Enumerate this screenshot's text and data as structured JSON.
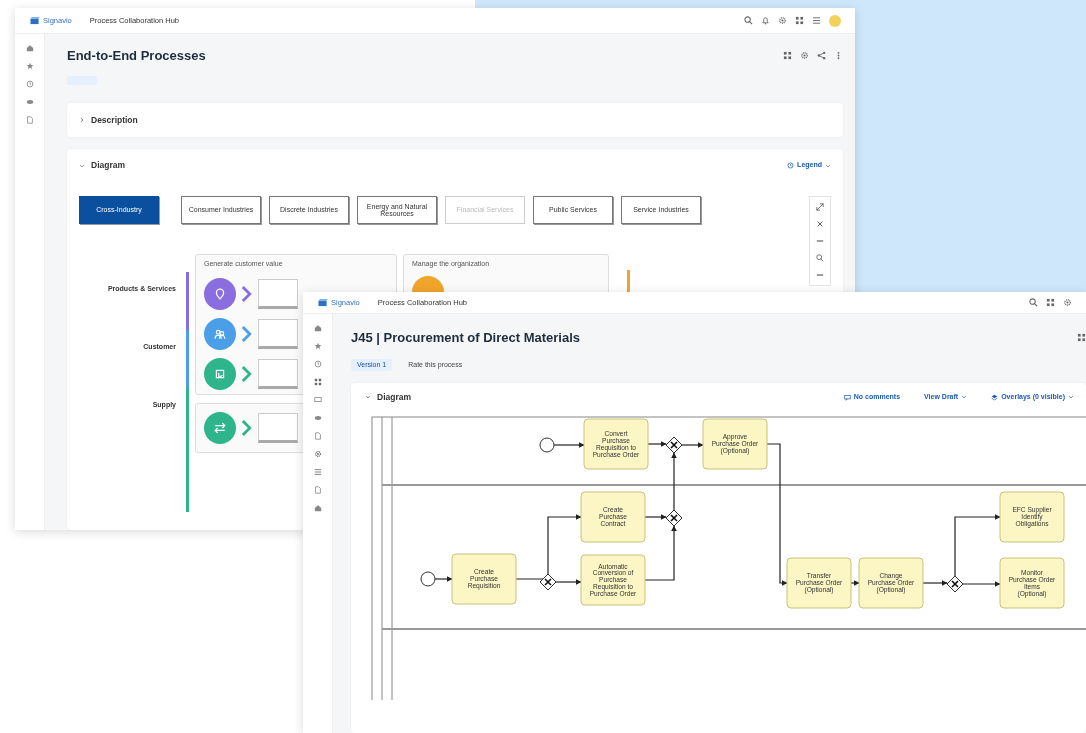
{
  "back_window": {
    "header": {
      "logo": "Signavio",
      "app_title": "Process Collaboration Hub"
    },
    "title": "End-to-End Processes",
    "sections": [
      "Description",
      "Diagram"
    ],
    "legend": "Legend",
    "industry_tabs": [
      {
        "label": "Cross-Industry",
        "selected": true,
        "disabled": false
      },
      {
        "label": "Consumer Industries",
        "selected": false,
        "disabled": false
      },
      {
        "label": "Discrete Industries",
        "selected": false,
        "disabled": false
      },
      {
        "label": "Energy and Natural Resources",
        "selected": false,
        "disabled": false
      },
      {
        "label": "Financial Services",
        "selected": false,
        "disabled": true
      },
      {
        "label": "Public Services",
        "selected": false,
        "disabled": false
      },
      {
        "label": "Service Industries",
        "selected": false,
        "disabled": false
      }
    ],
    "groups": [
      "Generate customer value",
      "Manage the organization"
    ],
    "lanes": [
      {
        "label": "Products & Services",
        "color": "#8a6ee0"
      },
      {
        "label": "Customer",
        "color": "#4b9fe9"
      },
      {
        "label": "Supply",
        "color": "#2eb58b"
      }
    ]
  },
  "front_window": {
    "header": {
      "logo": "Signavio",
      "app_title": "Process Collaboration Hub"
    },
    "title": "J45 | Procurement of Direct Materials",
    "version": "Version 1",
    "rate": "Rate this process",
    "section": "Diagram",
    "actions": [
      "No comments",
      "View Draft",
      "Overlays (0 visible)"
    ],
    "diagram": {
      "nodes": [
        {
          "kind": "start"
        },
        {
          "kind": "task",
          "label": "Convert Purchase Requisition to Purchase Order"
        },
        {
          "kind": "gateway"
        },
        {
          "kind": "task",
          "label": "Approve Purchase Order (Optional)"
        },
        {
          "kind": "task",
          "label": "Create Purchase Contract"
        },
        {
          "kind": "gateway"
        },
        {
          "kind": "start"
        },
        {
          "kind": "task",
          "label": "Create Purchase Requisition"
        },
        {
          "kind": "gateway"
        },
        {
          "kind": "task",
          "label": "Automatic Conversion of Purchase Requisition to Purchase Order"
        },
        {
          "kind": "task",
          "label": "Transfer Purchase Order (Optional)"
        },
        {
          "kind": "task",
          "label": "Change Purchase Order (Optional)"
        },
        {
          "kind": "gateway"
        },
        {
          "kind": "task",
          "label": "EFC Supplier Identify Obligations"
        },
        {
          "kind": "task",
          "label": "Monitor Purchase Order Items (Optional)"
        }
      ]
    }
  }
}
